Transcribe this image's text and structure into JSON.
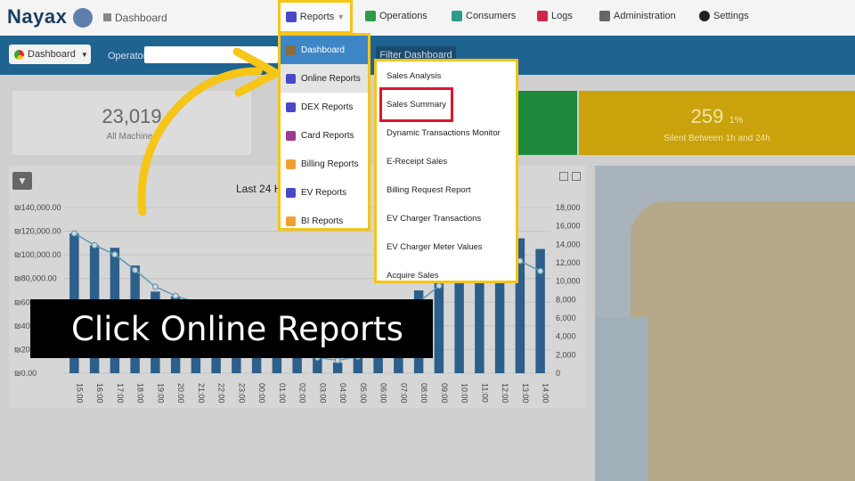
{
  "app": {
    "logo": "Nayax",
    "breadcrumb": "Dashboard"
  },
  "nav": {
    "reports": "Reports",
    "operations": "Operations",
    "consumers": "Consumers",
    "logs": "Logs",
    "administration": "Administration",
    "settings": "Settings"
  },
  "filterbar": {
    "dashboard_select": "Dashboard",
    "operator_label": "Operator",
    "operator_value": "",
    "filter_button": "Filter Dashboard"
  },
  "cards": {
    "machines_value": "23,019",
    "machines_label": "All Machines",
    "silent_value": "259",
    "silent_pct": "1%",
    "silent_label": "Silent Between 1h and 24h"
  },
  "chart_data": {
    "type": "bar",
    "title": "Last 24 H",
    "categories": [
      "15:00",
      "16:00",
      "17:00",
      "18:00",
      "19:00",
      "20:00",
      "21:00",
      "22:00",
      "23:00",
      "00:00",
      "01:00",
      "02:00",
      "03:00",
      "04:00",
      "05:00",
      "06:00",
      "07:00",
      "08:00",
      "09:00",
      "10:00",
      "11:00",
      "12:00",
      "13:00",
      "14:00"
    ],
    "ylim_left": [
      0,
      140000
    ],
    "yticks_left": [
      "₪0.00",
      "₪20,000.00",
      "₪40,000.00",
      "₪60,000.00",
      "₪80,000.00",
      "₪100,000.00",
      "₪120,000.00",
      "₪140,000.00"
    ],
    "ylim_right": [
      0,
      18000
    ],
    "yticks_right": [
      "0",
      "2,000",
      "4,000",
      "6,000",
      "8,000",
      "10,000",
      "12,000",
      "14,000",
      "16,000",
      "18,000"
    ],
    "series": [
      {
        "values": [
          118000,
          108000,
          106000,
          91000,
          69000,
          65000,
          62000,
          52000,
          43000,
          34000,
          24000,
          17000,
          13000,
          9000,
          14000,
          21000,
          38000,
          70000,
          96000,
          106000,
          116000,
          113000,
          114000,
          105000
        ]
      },
      {
        "values": [
          15200,
          13900,
          12900,
          11200,
          9400,
          8400,
          7700,
          6900,
          5600,
          4300,
          3200,
          2300,
          1700,
          1400,
          1800,
          2700,
          4800,
          7700,
          9500,
          10900,
          12100,
          12600,
          12200,
          11100
        ]
      }
    ]
  },
  "reports_menu": {
    "items": [
      {
        "label": "Dashboard",
        "icon": "dashboard-icon",
        "color": "#8a6d3b"
      },
      {
        "label": "Online Reports",
        "icon": "online-reports-icon",
        "color": "#4a48c8"
      },
      {
        "label": "DEX Reports",
        "icon": "dex-reports-icon",
        "color": "#4a48c8"
      },
      {
        "label": "Card Reports",
        "icon": "card-reports-icon",
        "color": "#9b3c92"
      },
      {
        "label": "Billing Reports",
        "icon": "billing-reports-icon",
        "color": "#f0a030"
      },
      {
        "label": "EV Reports",
        "icon": "ev-reports-icon",
        "color": "#4a48c8"
      },
      {
        "label": "BI Reports",
        "icon": "bi-reports-icon",
        "color": "#f0a030"
      }
    ]
  },
  "online_reports_submenu": {
    "items": [
      "Sales Analysis",
      "Sales Summary",
      "Dynamic Transactions Monitor",
      "E-Receipt Sales",
      "Billing Request Report",
      "EV Charger Transactions",
      "EV Charger Meter Values",
      "Acquire Sales"
    ]
  },
  "caption": "Click Online Reports",
  "colors": {
    "highlight": "#f5c518",
    "selection_box": "#e0152c",
    "nav_blue": "#1f6391"
  }
}
